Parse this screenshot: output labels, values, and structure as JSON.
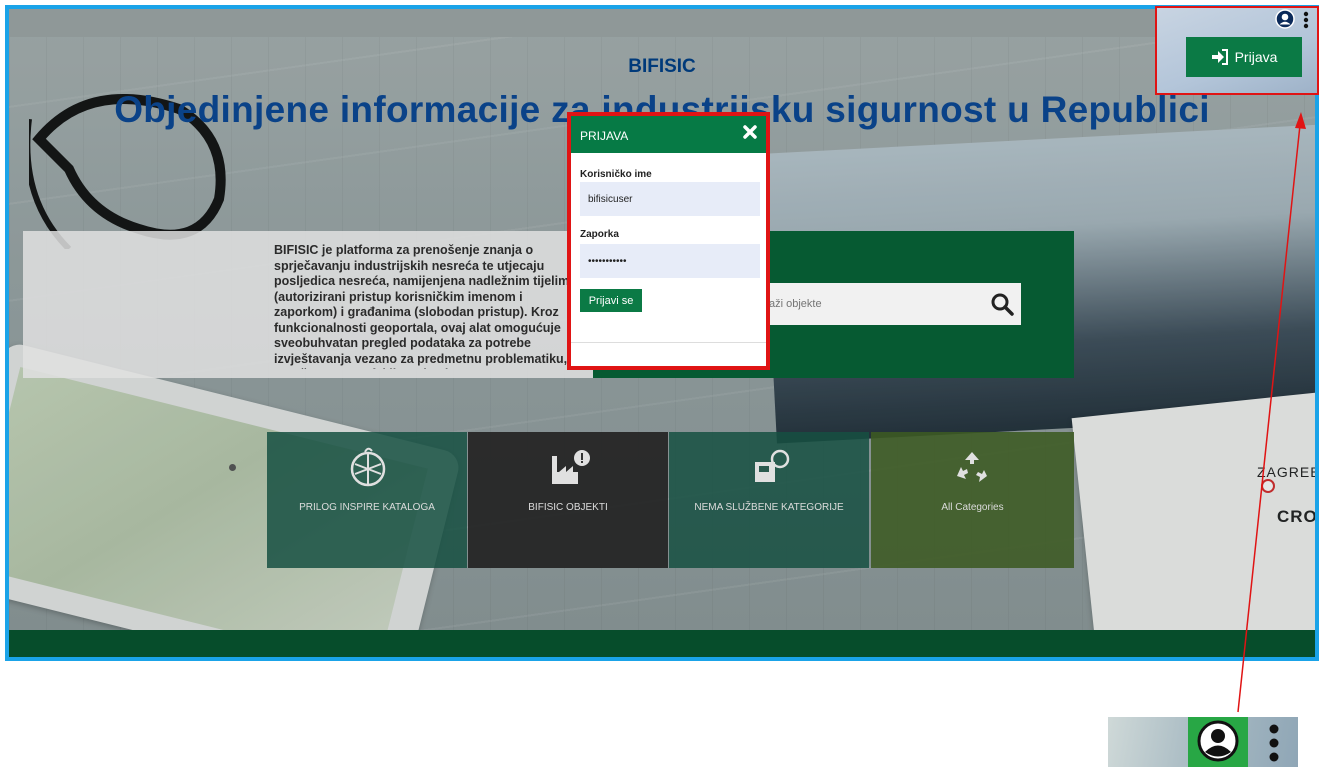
{
  "site": {
    "brand": "BIFISIC",
    "title": "Objedinjene informacije za industrijsku sigurnost u Republici",
    "description": "BIFISIC je platforma za prenošenje znanja o sprječavanju industrijskih nesreća te utjecaju posljedica nesreća, namijenjena nadležnim tijelima (autorizirani pristup korisničkim imenom i zaporkom) i građanima (slobodan pristup). Kroz funkcionalnosti geoportala, ovaj alat omogućuje sveobuhvatan pregled podataka za potrebe izvještavanja vezano za predmetnu problematiku, te mnoštvo geografskih podataka."
  },
  "search": {
    "placeholder": "Traži objekte"
  },
  "categories": [
    {
      "label": "PRILOG INSPIRE KATALOGA",
      "icon": "globe-icon"
    },
    {
      "label": "BIFISIC OBJEKTI",
      "icon": "factory-alert-icon"
    },
    {
      "label": "NEMA SLUŽBENE KATEGORIJE",
      "icon": "book-globe-icon"
    },
    {
      "label": "All Categories",
      "icon": "recycle-icon"
    }
  ],
  "login_modal": {
    "title": "PRIJAVA",
    "username_label": "Korisničko ime",
    "username_value": "bifisicuser",
    "password_label": "Zaporka",
    "password_value": "•••••••••••",
    "submit_label": "Prijavi se"
  },
  "header": {
    "login_button": "Prijava",
    "user_icon": "user-circle-icon",
    "menu_icon": "kebab-menu-icon"
  },
  "map_labels": {
    "city": "ZAGREB",
    "country": "CROA"
  },
  "colors": {
    "brand_green": "#0b7a45",
    "title_blue": "#0a4288",
    "highlight_red": "#e01414",
    "frame_blue": "#1aa3e8"
  }
}
